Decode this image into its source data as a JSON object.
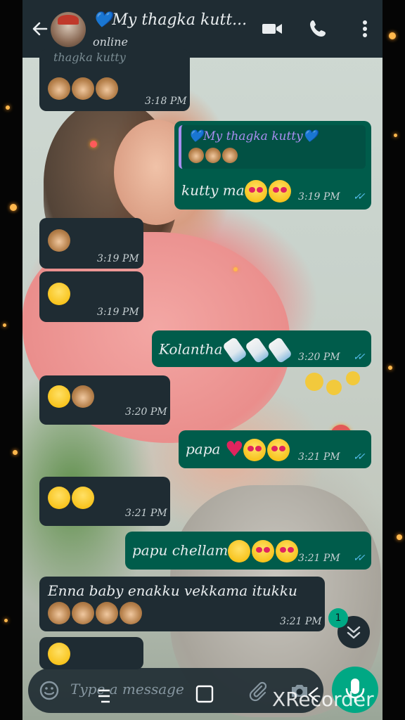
{
  "header": {
    "contact_name": "💙My thagka kutt...",
    "status": "online"
  },
  "messages": [
    {
      "id": "m1",
      "direction": "incoming",
      "text": "",
      "emoji": [
        "see-no-evil-monkey",
        "see-no-evil-monkey",
        "see-no-evil-monkey"
      ],
      "time": "3:18 PM",
      "quoted_fragment": "thagka kutty"
    },
    {
      "id": "m2",
      "direction": "outgoing",
      "quoted_name": "💙My thagka kutty💙",
      "quoted_emoji": [
        "see-no-evil-monkey",
        "see-no-evil-monkey",
        "see-no-evil-monkey"
      ],
      "text": "kutty ma",
      "emoji": [
        "smiling-face-with-hearts",
        "heart-eyes"
      ],
      "time": "3:19 PM",
      "read": true
    },
    {
      "id": "m3",
      "direction": "incoming",
      "text": "",
      "emoji": [
        "see-no-evil-monkey"
      ],
      "time": "3:19 PM"
    },
    {
      "id": "m4",
      "direction": "incoming",
      "text": "",
      "emoji": [
        "nerd-face"
      ],
      "time": "3:19 PM"
    },
    {
      "id": "m5",
      "direction": "outgoing",
      "text": "Kolantha",
      "emoji": [
        "baby-bottle",
        "baby-bottle",
        "baby-bottle"
      ],
      "time": "3:20 PM",
      "read": true
    },
    {
      "id": "m6",
      "direction": "incoming",
      "text": "",
      "emoji": [
        "hand-over-mouth",
        "see-no-evil-monkey"
      ],
      "time": "3:20 PM"
    },
    {
      "id": "m7",
      "direction": "outgoing",
      "text": "papa",
      "emoji": [
        "red-heart",
        "smiling-face-with-hearts",
        "heart-eyes"
      ],
      "time": "3:21 PM",
      "read": true
    },
    {
      "id": "m8",
      "direction": "incoming",
      "text": "",
      "emoji": [
        "grinning-face",
        "hand-over-mouth"
      ],
      "time": "3:21 PM"
    },
    {
      "id": "m9",
      "direction": "outgoing",
      "text": "papu chellam",
      "emoji": [
        "squinting-tongue",
        "smiling-face-with-hearts",
        "heart-eyes"
      ],
      "time": "3:21 PM",
      "read": true
    },
    {
      "id": "m10",
      "direction": "incoming",
      "text": "Enna baby enakku vekkama itukku",
      "emoji": [
        "see-no-evil-monkey",
        "see-no-evil-monkey",
        "see-no-evil-monkey",
        "see-no-evil-monkey"
      ],
      "time": "3:21 PM"
    },
    {
      "id": "m11",
      "direction": "incoming",
      "text": "",
      "emoji": [
        "star-struck"
      ],
      "time": ""
    }
  ],
  "unread_count": "1",
  "input": {
    "placeholder": "Type a message"
  },
  "watermark": "XRecorder",
  "colors": {
    "header_bg": "#1f2c33",
    "incoming_bubble": "#1f2c33",
    "outgoing_bubble": "#005c4b",
    "accent_green": "#00a884",
    "read_ticks": "#53bdeb",
    "quote_name": "#a98ef0"
  },
  "icons": [
    "back-arrow-icon",
    "video-call-icon",
    "phone-call-icon",
    "more-options-icon",
    "emoji-icon",
    "attach-icon",
    "camera-icon",
    "mic-icon",
    "scroll-down-icon"
  ]
}
